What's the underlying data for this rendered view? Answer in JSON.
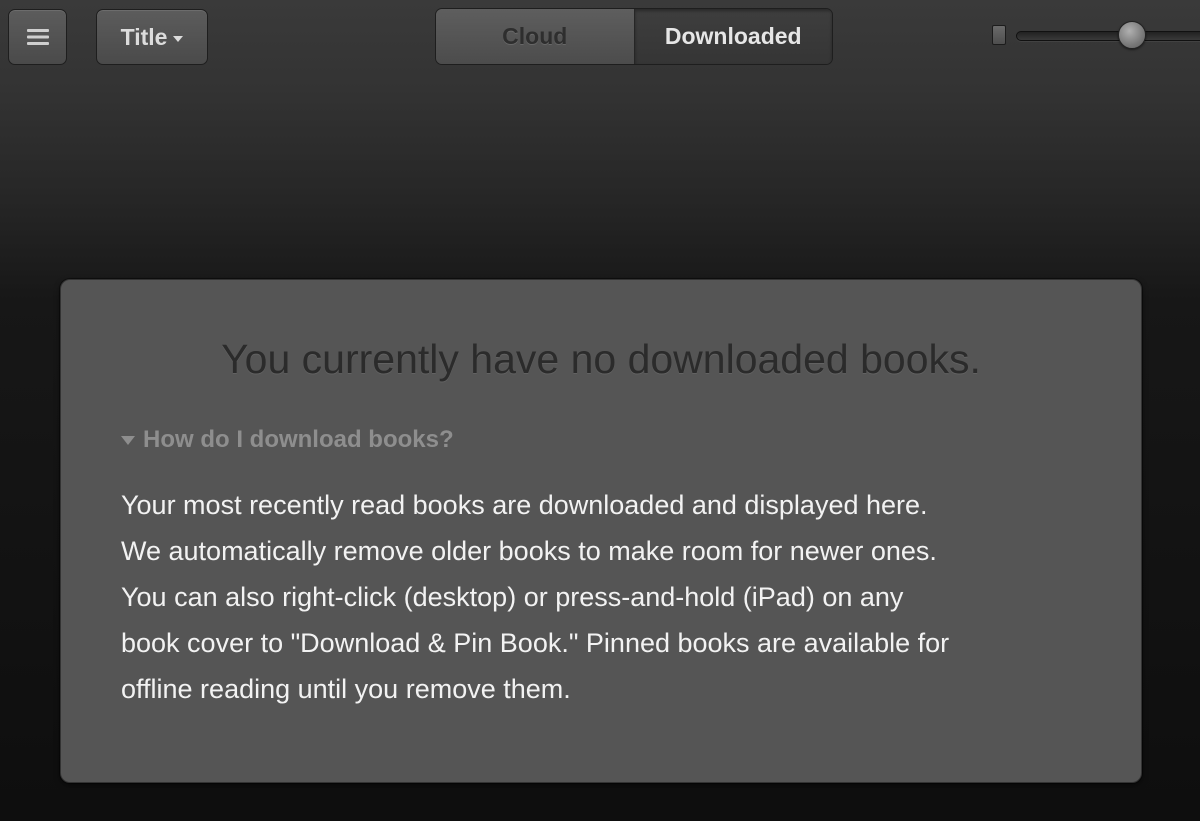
{
  "toolbar": {
    "menu_icon": "hamburger-menu-icon",
    "sort_label": "Title",
    "sort_caret_icon": "caret-down-icon",
    "tabs": [
      {
        "label": "Cloud",
        "selected": false
      },
      {
        "label": "Downloaded",
        "selected": true
      }
    ],
    "zoom_slider": {
      "small_icon": "small-book-size-icon",
      "value": 0.58
    }
  },
  "panel": {
    "title": "You currently have no downloaded books.",
    "faq_toggle_icon": "disclosure-triangle-down-icon",
    "faq_question": "How do I download books?",
    "faq_answer_lines": [
      "Your most recently read books are downloaded and displayed here.",
      "We automatically remove older books to make room for newer ones.",
      "You can also right-click (desktop) or press-and-hold (iPad) on any",
      "book cover to \"Download & Pin Book.\" Pinned books are available for",
      "offline reading until you remove them."
    ]
  },
  "colors": {
    "panel_background": "#555555",
    "selected_tab_text": "#e6e6e6",
    "unselected_tab_text": "#2e2e2e",
    "faq_question_text": "#8e8e8e",
    "body_text": "#f2f2f2"
  }
}
